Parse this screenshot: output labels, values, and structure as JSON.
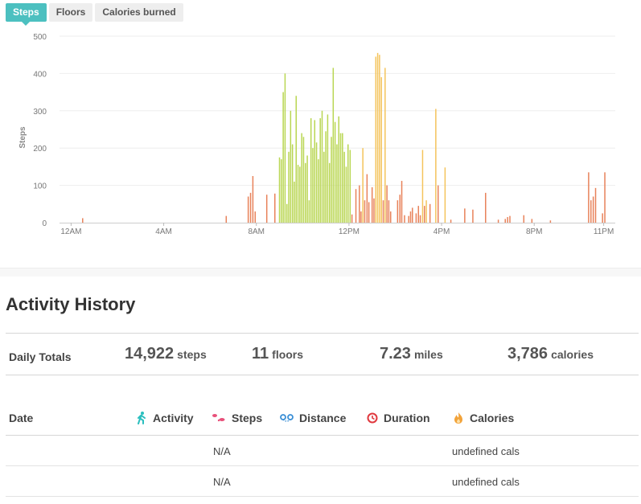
{
  "tabs": [
    {
      "label": "Steps",
      "active": true
    },
    {
      "label": "Floors",
      "active": false
    },
    {
      "label": "Calories burned",
      "active": false
    }
  ],
  "chart_data": {
    "type": "bar",
    "ylabel": "Steps",
    "xlabel": "",
    "ylim": [
      0,
      500
    ],
    "yticks": [
      0,
      100,
      200,
      300,
      400,
      500
    ],
    "xlim_hours": [
      -0.5,
      23.5
    ],
    "xticks": [
      {
        "label": "12AM",
        "hour": 0
      },
      {
        "label": "4AM",
        "hour": 4
      },
      {
        "label": "8AM",
        "hour": 8
      },
      {
        "label": "12PM",
        "hour": 12
      },
      {
        "label": "4PM",
        "hour": 16
      },
      {
        "label": "8PM",
        "hour": 20
      },
      {
        "label": "11PM",
        "hour": 23
      }
    ],
    "grid": true,
    "level_colors": {
      "low": "#e8825a",
      "medium": "#f4c45c",
      "high": "#b9d652"
    },
    "bars": [
      {
        "hour": 0.5,
        "value": 12,
        "level": "low"
      },
      {
        "hour": 6.7,
        "value": 18,
        "level": "low"
      },
      {
        "hour": 7.65,
        "value": 70,
        "level": "low"
      },
      {
        "hour": 7.75,
        "value": 80,
        "level": "low"
      },
      {
        "hour": 7.85,
        "value": 125,
        "level": "low"
      },
      {
        "hour": 7.95,
        "value": 30,
        "level": "low"
      },
      {
        "hour": 8.45,
        "value": 75,
        "level": "low"
      },
      {
        "hour": 8.8,
        "value": 78,
        "level": "low"
      },
      {
        "hour": 9.0,
        "value": 175,
        "level": "high"
      },
      {
        "hour": 9.08,
        "value": 170,
        "level": "high"
      },
      {
        "hour": 9.16,
        "value": 350,
        "level": "high"
      },
      {
        "hour": 9.24,
        "value": 400,
        "level": "high"
      },
      {
        "hour": 9.32,
        "value": 50,
        "level": "high"
      },
      {
        "hour": 9.4,
        "value": 190,
        "level": "high"
      },
      {
        "hour": 9.48,
        "value": 300,
        "level": "high"
      },
      {
        "hour": 9.56,
        "value": 210,
        "level": "high"
      },
      {
        "hour": 9.64,
        "value": 110,
        "level": "high"
      },
      {
        "hour": 9.72,
        "value": 340,
        "level": "high"
      },
      {
        "hour": 9.8,
        "value": 155,
        "level": "high"
      },
      {
        "hour": 9.88,
        "value": 150,
        "level": "high"
      },
      {
        "hour": 9.96,
        "value": 240,
        "level": "high"
      },
      {
        "hour": 10.04,
        "value": 230,
        "level": "high"
      },
      {
        "hour": 10.12,
        "value": 160,
        "level": "high"
      },
      {
        "hour": 10.2,
        "value": 180,
        "level": "high"
      },
      {
        "hour": 10.28,
        "value": 60,
        "level": "high"
      },
      {
        "hour": 10.36,
        "value": 280,
        "level": "high"
      },
      {
        "hour": 10.44,
        "value": 200,
        "level": "high"
      },
      {
        "hour": 10.52,
        "value": 275,
        "level": "high"
      },
      {
        "hour": 10.6,
        "value": 215,
        "level": "high"
      },
      {
        "hour": 10.68,
        "value": 170,
        "level": "high"
      },
      {
        "hour": 10.76,
        "value": 280,
        "level": "high"
      },
      {
        "hour": 10.84,
        "value": 300,
        "level": "high"
      },
      {
        "hour": 10.92,
        "value": 190,
        "level": "high"
      },
      {
        "hour": 11.0,
        "value": 245,
        "level": "high"
      },
      {
        "hour": 11.08,
        "value": 290,
        "level": "high"
      },
      {
        "hour": 11.16,
        "value": 160,
        "level": "high"
      },
      {
        "hour": 11.24,
        "value": 230,
        "level": "high"
      },
      {
        "hour": 11.32,
        "value": 415,
        "level": "high"
      },
      {
        "hour": 11.4,
        "value": 270,
        "level": "high"
      },
      {
        "hour": 11.48,
        "value": 210,
        "level": "high"
      },
      {
        "hour": 11.56,
        "value": 285,
        "level": "high"
      },
      {
        "hour": 11.64,
        "value": 240,
        "level": "high"
      },
      {
        "hour": 11.72,
        "value": 240,
        "level": "high"
      },
      {
        "hour": 11.8,
        "value": 190,
        "level": "high"
      },
      {
        "hour": 11.88,
        "value": 150,
        "level": "high"
      },
      {
        "hour": 11.96,
        "value": 210,
        "level": "high"
      },
      {
        "hour": 12.05,
        "value": 195,
        "level": "high"
      },
      {
        "hour": 12.13,
        "value": 22,
        "level": "low"
      },
      {
        "hour": 12.3,
        "value": 90,
        "level": "low"
      },
      {
        "hour": 12.45,
        "value": 100,
        "level": "low"
      },
      {
        "hour": 12.52,
        "value": 30,
        "level": "low"
      },
      {
        "hour": 12.6,
        "value": 200,
        "level": "medium"
      },
      {
        "hour": 12.68,
        "value": 60,
        "level": "low"
      },
      {
        "hour": 12.78,
        "value": 130,
        "level": "low"
      },
      {
        "hour": 12.86,
        "value": 55,
        "level": "low"
      },
      {
        "hour": 13.0,
        "value": 95,
        "level": "low"
      },
      {
        "hour": 13.08,
        "value": 65,
        "level": "low"
      },
      {
        "hour": 13.16,
        "value": 445,
        "level": "medium"
      },
      {
        "hour": 13.24,
        "value": 455,
        "level": "medium"
      },
      {
        "hour": 13.32,
        "value": 450,
        "level": "medium"
      },
      {
        "hour": 13.4,
        "value": 390,
        "level": "medium"
      },
      {
        "hour": 13.48,
        "value": 60,
        "level": "low"
      },
      {
        "hour": 13.56,
        "value": 415,
        "level": "medium"
      },
      {
        "hour": 13.64,
        "value": 100,
        "level": "low"
      },
      {
        "hour": 13.72,
        "value": 60,
        "level": "low"
      },
      {
        "hour": 13.8,
        "value": 30,
        "level": "low"
      },
      {
        "hour": 14.1,
        "value": 60,
        "level": "low"
      },
      {
        "hour": 14.2,
        "value": 75,
        "level": "low"
      },
      {
        "hour": 14.28,
        "value": 112,
        "level": "low"
      },
      {
        "hour": 14.4,
        "value": 20,
        "level": "low"
      },
      {
        "hour": 14.58,
        "value": 18,
        "level": "low"
      },
      {
        "hour": 14.66,
        "value": 30,
        "level": "low"
      },
      {
        "hour": 14.74,
        "value": 40,
        "level": "low"
      },
      {
        "hour": 14.9,
        "value": 25,
        "level": "low"
      },
      {
        "hour": 15.0,
        "value": 45,
        "level": "low"
      },
      {
        "hour": 15.08,
        "value": 20,
        "level": "low"
      },
      {
        "hour": 15.18,
        "value": 195,
        "level": "medium"
      },
      {
        "hour": 15.26,
        "value": 45,
        "level": "low"
      },
      {
        "hour": 15.34,
        "value": 60,
        "level": "medium"
      },
      {
        "hour": 15.5,
        "value": 50,
        "level": "low"
      },
      {
        "hour": 15.75,
        "value": 305,
        "level": "medium"
      },
      {
        "hour": 15.85,
        "value": 100,
        "level": "low"
      },
      {
        "hour": 16.15,
        "value": 148,
        "level": "medium"
      },
      {
        "hour": 16.4,
        "value": 8,
        "level": "low"
      },
      {
        "hour": 17.0,
        "value": 38,
        "level": "low"
      },
      {
        "hour": 17.35,
        "value": 35,
        "level": "low"
      },
      {
        "hour": 17.9,
        "value": 80,
        "level": "low"
      },
      {
        "hour": 18.45,
        "value": 8,
        "level": "low"
      },
      {
        "hour": 18.75,
        "value": 10,
        "level": "low"
      },
      {
        "hour": 18.85,
        "value": 15,
        "level": "low"
      },
      {
        "hour": 18.95,
        "value": 18,
        "level": "low"
      },
      {
        "hour": 19.55,
        "value": 20,
        "level": "low"
      },
      {
        "hour": 19.9,
        "value": 10,
        "level": "low"
      },
      {
        "hour": 20.7,
        "value": 6,
        "level": "low"
      },
      {
        "hour": 22.35,
        "value": 135,
        "level": "low"
      },
      {
        "hour": 22.45,
        "value": 60,
        "level": "low"
      },
      {
        "hour": 22.55,
        "value": 70,
        "level": "low"
      },
      {
        "hour": 22.65,
        "value": 93,
        "level": "low"
      },
      {
        "hour": 22.95,
        "value": 25,
        "level": "low"
      },
      {
        "hour": 23.05,
        "value": 135,
        "level": "low"
      }
    ]
  },
  "activity_history": {
    "title": "Activity History",
    "totals_label": "Daily Totals",
    "totals": [
      {
        "value": "14,922",
        "unit": "steps"
      },
      {
        "value": "11",
        "unit": "floors"
      },
      {
        "value": "7.23",
        "unit": "miles"
      },
      {
        "value": "3,786",
        "unit": "calories"
      }
    ],
    "columns": {
      "date": "Date",
      "activity": {
        "label": "Activity",
        "icon": "walking-person-icon",
        "color": "#2bbfbf"
      },
      "steps": {
        "label": "Steps",
        "icon": "footprints-icon",
        "color": "#e8507a"
      },
      "distance": {
        "label": "Distance",
        "icon": "distance-icon",
        "color": "#3b8fd6"
      },
      "duration": {
        "label": "Duration",
        "icon": "clock-icon",
        "color": "#e0383e"
      },
      "calories": {
        "label": "Calories",
        "icon": "flame-icon",
        "color": "#f2a33a"
      }
    },
    "rows": [
      {
        "date": "",
        "activity": "",
        "steps": "N/A",
        "distance": "",
        "duration": "",
        "calories": "undefined cals"
      },
      {
        "date": "",
        "activity": "",
        "steps": "N/A",
        "distance": "",
        "duration": "",
        "calories": "undefined cals"
      }
    ]
  }
}
